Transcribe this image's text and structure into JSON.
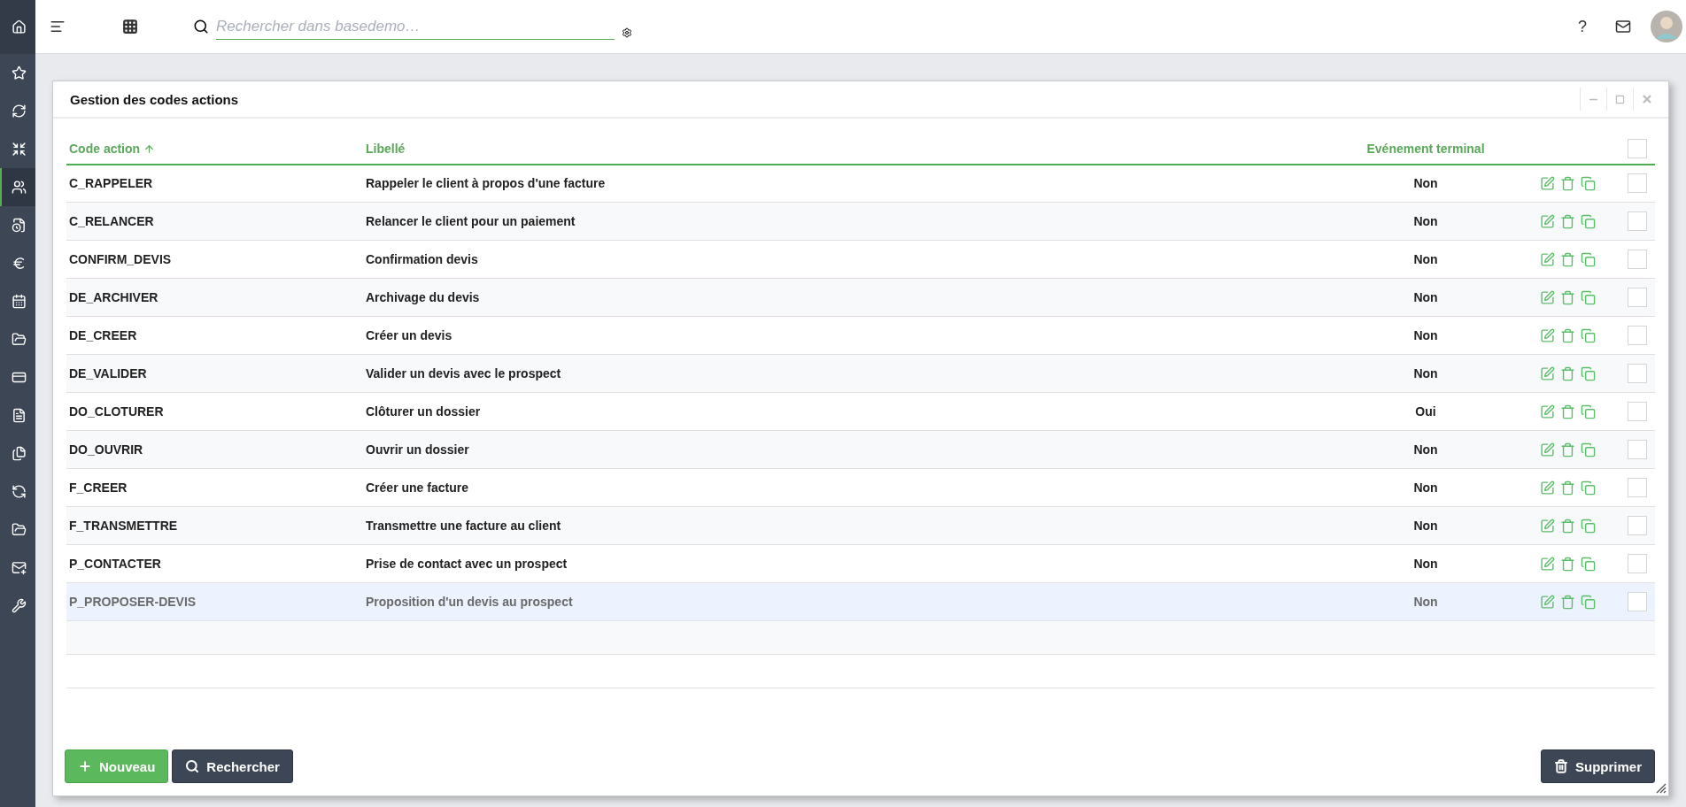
{
  "sidebar": {
    "items": [
      {
        "selected": false
      },
      {
        "selected": false
      },
      {
        "selected": false
      },
      {
        "selected": false
      },
      {
        "selected": true
      },
      {
        "selected": false
      },
      {
        "selected": false
      },
      {
        "selected": false
      },
      {
        "selected": false
      },
      {
        "selected": false
      },
      {
        "selected": false
      },
      {
        "selected": false
      },
      {
        "selected": false
      },
      {
        "selected": false
      },
      {
        "selected": false
      },
      {
        "selected": false
      }
    ]
  },
  "topbar": {
    "search": {
      "placeholder": "Rechercher dans basedemo…"
    },
    "help": "?"
  },
  "window": {
    "title": "Gestion des codes actions"
  },
  "table": {
    "columns": [
      {
        "label": "Code action",
        "sorted": true
      },
      {
        "label": "Libellé",
        "sorted": false
      },
      {
        "label": "Evénement terminal",
        "sorted": false
      }
    ],
    "header_checked": false,
    "rows": [
      {
        "code": "C_RAPPELER",
        "label": "Rappeler le client à propos d'une facture",
        "terminal": "Non",
        "selected": false,
        "checked": false
      },
      {
        "code": "C_RELANCER",
        "label": "Relancer le client pour un paiement",
        "terminal": "Non",
        "selected": false,
        "checked": false
      },
      {
        "code": "CONFIRM_DEVIS",
        "label": "Confirmation devis",
        "terminal": "Non",
        "selected": false,
        "checked": false
      },
      {
        "code": "DE_ARCHIVER",
        "label": "Archivage du devis",
        "terminal": "Non",
        "selected": false,
        "checked": false
      },
      {
        "code": "DE_CREER",
        "label": "Créer un devis",
        "terminal": "Non",
        "selected": false,
        "checked": false
      },
      {
        "code": "DE_VALIDER",
        "label": "Valider un devis avec le prospect",
        "terminal": "Non",
        "selected": false,
        "checked": false
      },
      {
        "code": "DO_CLOTURER",
        "label": "Clôturer un dossier",
        "terminal": "Oui",
        "selected": false,
        "checked": false
      },
      {
        "code": "DO_OUVRIR",
        "label": "Ouvrir un dossier",
        "terminal": "Non",
        "selected": false,
        "checked": false
      },
      {
        "code": "F_CREER",
        "label": "Créer une facture",
        "terminal": "Non",
        "selected": false,
        "checked": false
      },
      {
        "code": "F_TRANSMETTRE",
        "label": "Transmettre une facture au client",
        "terminal": "Non",
        "selected": false,
        "checked": false
      },
      {
        "code": "P_CONTACTER",
        "label": "Prise de contact avec un prospect",
        "terminal": "Non",
        "selected": false,
        "checked": false
      },
      {
        "code": "P_PROPOSER-DEVIS",
        "label": "Proposition d'un devis au prospect",
        "terminal": "Non",
        "selected": true,
        "checked": false
      }
    ]
  },
  "buttons": [
    {
      "kind": "new",
      "label": "Nouveau"
    },
    {
      "kind": "search",
      "label": "Rechercher"
    },
    {
      "kind": "delete",
      "label": "Supprimer"
    }
  ]
}
